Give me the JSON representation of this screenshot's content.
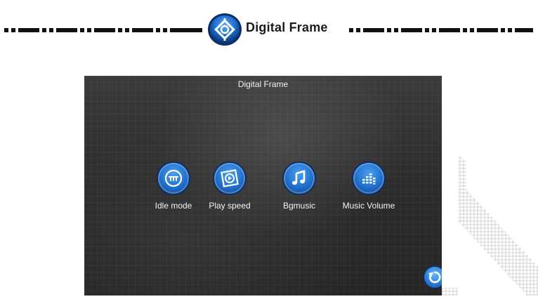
{
  "header": {
    "title": "Digital Frame",
    "icon": "frame-settings-icon"
  },
  "screen": {
    "title": "Digital Frame",
    "menu": [
      {
        "label": "Idle mode",
        "icon": "idle-mode-icon"
      },
      {
        "label": "Play speed",
        "icon": "play-speed-icon"
      },
      {
        "label": "Bgmusic",
        "icon": "music-note-icon"
      },
      {
        "label": "Music Volume",
        "icon": "volume-bars-icon"
      }
    ],
    "back_icon": "refresh-back-icon"
  },
  "colors": {
    "accent": "#1f6fcb",
    "screen_bg": "#2e2e2e",
    "header_text": "#1c1c1c"
  }
}
